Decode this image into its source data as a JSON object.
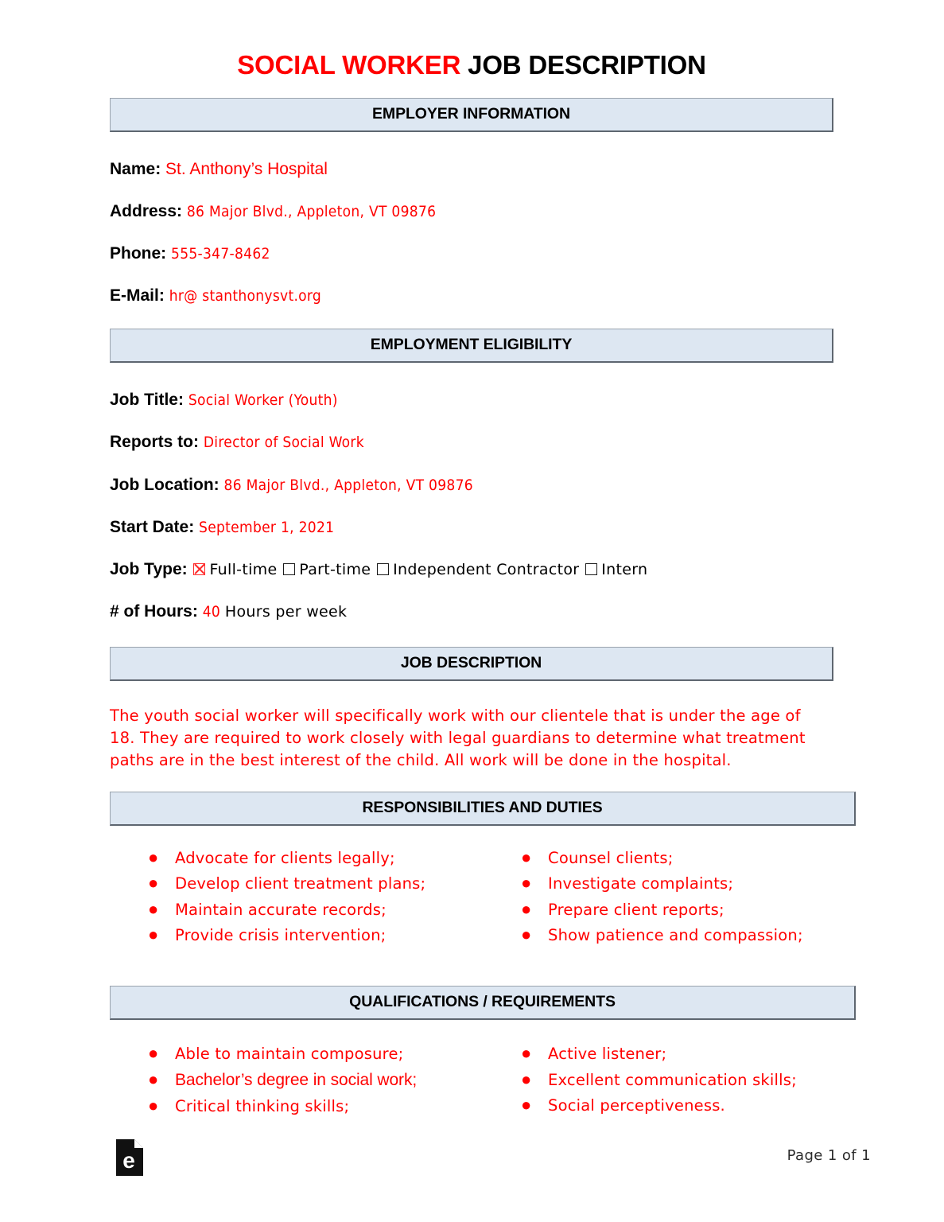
{
  "document": {
    "title_highlight": "SOCIAL WORKER",
    "title_rest": " JOB DESCRIPTION"
  },
  "colors": {
    "accent_red": "#ff0000",
    "section_bar_fill": "#dde7f2",
    "section_bar_border": "#5e6670",
    "text_black": "#000000"
  },
  "sections": {
    "employer": {
      "heading": "EMPLOYER INFORMATION",
      "fields": [
        {
          "label": "Name",
          "separator": ":",
          "value": "St. Anthony’s Hospital"
        },
        {
          "label": "Address",
          "separator": ":",
          "value": "86 Major Blvd., Appleton, VT 09876"
        },
        {
          "label": "Phone",
          "separator": ":",
          "value": "555-347-8462"
        },
        {
          "label": "E-Mail",
          "separator": ":",
          "value": "hr@ stanthonysvt.org"
        }
      ]
    },
    "eligibility": {
      "heading": "EMPLOYMENT ELIGIBILITY",
      "fields": [
        {
          "label": "Job Title",
          "separator": ":",
          "value": "Social Worker (Youth)"
        },
        {
          "label": "Reports to",
          "separator": ":",
          "value": "Director of Social Work"
        },
        {
          "label": "Job Location",
          "separator": ":",
          "value": "86 Major Blvd., Appleton, VT 09876"
        },
        {
          "label": "Start Date",
          "separator": ":",
          "value": "September 1, 2021"
        }
      ],
      "job_type": {
        "label": "Job Type",
        "separator": ":",
        "options": [
          {
            "text": "Full-time",
            "checked": true
          },
          {
            "text": "Part-time",
            "checked": false
          },
          {
            "text": "Independent Contractor",
            "checked": false
          },
          {
            "text": "Intern",
            "checked": false
          }
        ]
      },
      "hours": {
        "label": "# of Hours",
        "separator": ":",
        "value": "40",
        "suffix": "Hours per week"
      }
    },
    "job_description": {
      "heading": "JOB DESCRIPTION",
      "body": "The youth social worker will specifically work with our clientele that is under the age of 18. They are required to work closely with legal guardians to determine what treatment paths are in the best interest of the child. All work will be done in the hospital."
    },
    "responsibilities": {
      "heading": "RESPONSIBILITIES AND DUTIES",
      "left_column": [
        "Advocate for clients legally;",
        "Develop client treatment plans;",
        "Maintain accurate records;",
        "Provide crisis intervention;"
      ],
      "right_column": [
        "Counsel clients;",
        "Investigate complaints;",
        "Prepare client reports;",
        "Show patience and compassion;"
      ]
    },
    "qualifications": {
      "heading": "QUALIFICATIONS / REQUIREMENTS",
      "left_column": [
        {
          "text": "Able to maintain composure;",
          "style": "handwritten"
        },
        {
          "text": "Bachelor’s degree in social work;",
          "style": "typed"
        },
        {
          "text": "Critical thinking skills;",
          "style": "handwritten"
        }
      ],
      "right_column": [
        {
          "text": "Active listener;",
          "style": "handwritten"
        },
        {
          "text": "Excellent communication skills;",
          "style": "handwritten"
        },
        {
          "text": "Social perceptiveness.",
          "style": "handwritten"
        }
      ]
    }
  },
  "footer": {
    "logo_letter": "e",
    "page_label": "Page 1 of 1"
  }
}
